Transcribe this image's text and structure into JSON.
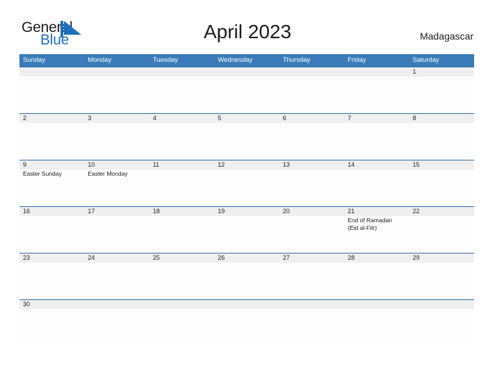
{
  "brand": {
    "name_part1": "General",
    "name_part2": "Blue",
    "mark_color": "#1e6fba"
  },
  "header": {
    "title": "April 2023",
    "locale": "Madagascar"
  },
  "theme": {
    "header_blue": "#3a7cb9",
    "divider_blue": "#2e6da4",
    "band_gray": "#efefef",
    "text_dark": "#1a1a1a"
  },
  "calendar": {
    "day_headers": [
      "Sunday",
      "Monday",
      "Tuesday",
      "Wednesday",
      "Thursday",
      "Friday",
      "Saturday"
    ],
    "weeks": [
      {
        "days": [
          {
            "num": "",
            "events": []
          },
          {
            "num": "",
            "events": []
          },
          {
            "num": "",
            "events": []
          },
          {
            "num": "",
            "events": []
          },
          {
            "num": "",
            "events": []
          },
          {
            "num": "",
            "events": []
          },
          {
            "num": "1",
            "events": []
          }
        ]
      },
      {
        "days": [
          {
            "num": "2",
            "events": []
          },
          {
            "num": "3",
            "events": []
          },
          {
            "num": "4",
            "events": []
          },
          {
            "num": "5",
            "events": []
          },
          {
            "num": "6",
            "events": []
          },
          {
            "num": "7",
            "events": []
          },
          {
            "num": "8",
            "events": []
          }
        ]
      },
      {
        "days": [
          {
            "num": "9",
            "events": [
              "Easter Sunday"
            ]
          },
          {
            "num": "10",
            "events": [
              "Easter Monday"
            ]
          },
          {
            "num": "11",
            "events": []
          },
          {
            "num": "12",
            "events": []
          },
          {
            "num": "13",
            "events": []
          },
          {
            "num": "14",
            "events": []
          },
          {
            "num": "15",
            "events": []
          }
        ]
      },
      {
        "days": [
          {
            "num": "16",
            "events": []
          },
          {
            "num": "17",
            "events": []
          },
          {
            "num": "18",
            "events": []
          },
          {
            "num": "19",
            "events": []
          },
          {
            "num": "20",
            "events": []
          },
          {
            "num": "21",
            "events": [
              "End of Ramadan",
              "(Eid al-Fitr)"
            ]
          },
          {
            "num": "22",
            "events": []
          }
        ]
      },
      {
        "days": [
          {
            "num": "23",
            "events": []
          },
          {
            "num": "24",
            "events": []
          },
          {
            "num": "25",
            "events": []
          },
          {
            "num": "26",
            "events": []
          },
          {
            "num": "27",
            "events": []
          },
          {
            "num": "28",
            "events": []
          },
          {
            "num": "29",
            "events": []
          }
        ]
      },
      {
        "days": [
          {
            "num": "30",
            "events": []
          },
          {
            "num": "",
            "events": []
          },
          {
            "num": "",
            "events": []
          },
          {
            "num": "",
            "events": []
          },
          {
            "num": "",
            "events": []
          },
          {
            "num": "",
            "events": []
          },
          {
            "num": "",
            "events": []
          }
        ]
      }
    ]
  }
}
